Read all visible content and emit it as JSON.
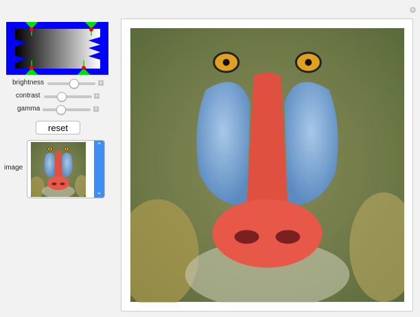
{
  "controls": {
    "sliders": [
      {
        "label": "brightness",
        "value": 0.55
      },
      {
        "label": "contrast",
        "value": 0.33
      },
      {
        "label": "gamma",
        "value": 0.35
      }
    ],
    "reset_label": "reset",
    "image_label": "image",
    "plus_glyph": "+",
    "scroll_up": "⌃",
    "scroll_down": "⌄"
  },
  "colors": {
    "graph_bg": "#0000ff",
    "handle": "#00e000",
    "point": "#ff0000",
    "scroll": "#3d8ff5"
  }
}
